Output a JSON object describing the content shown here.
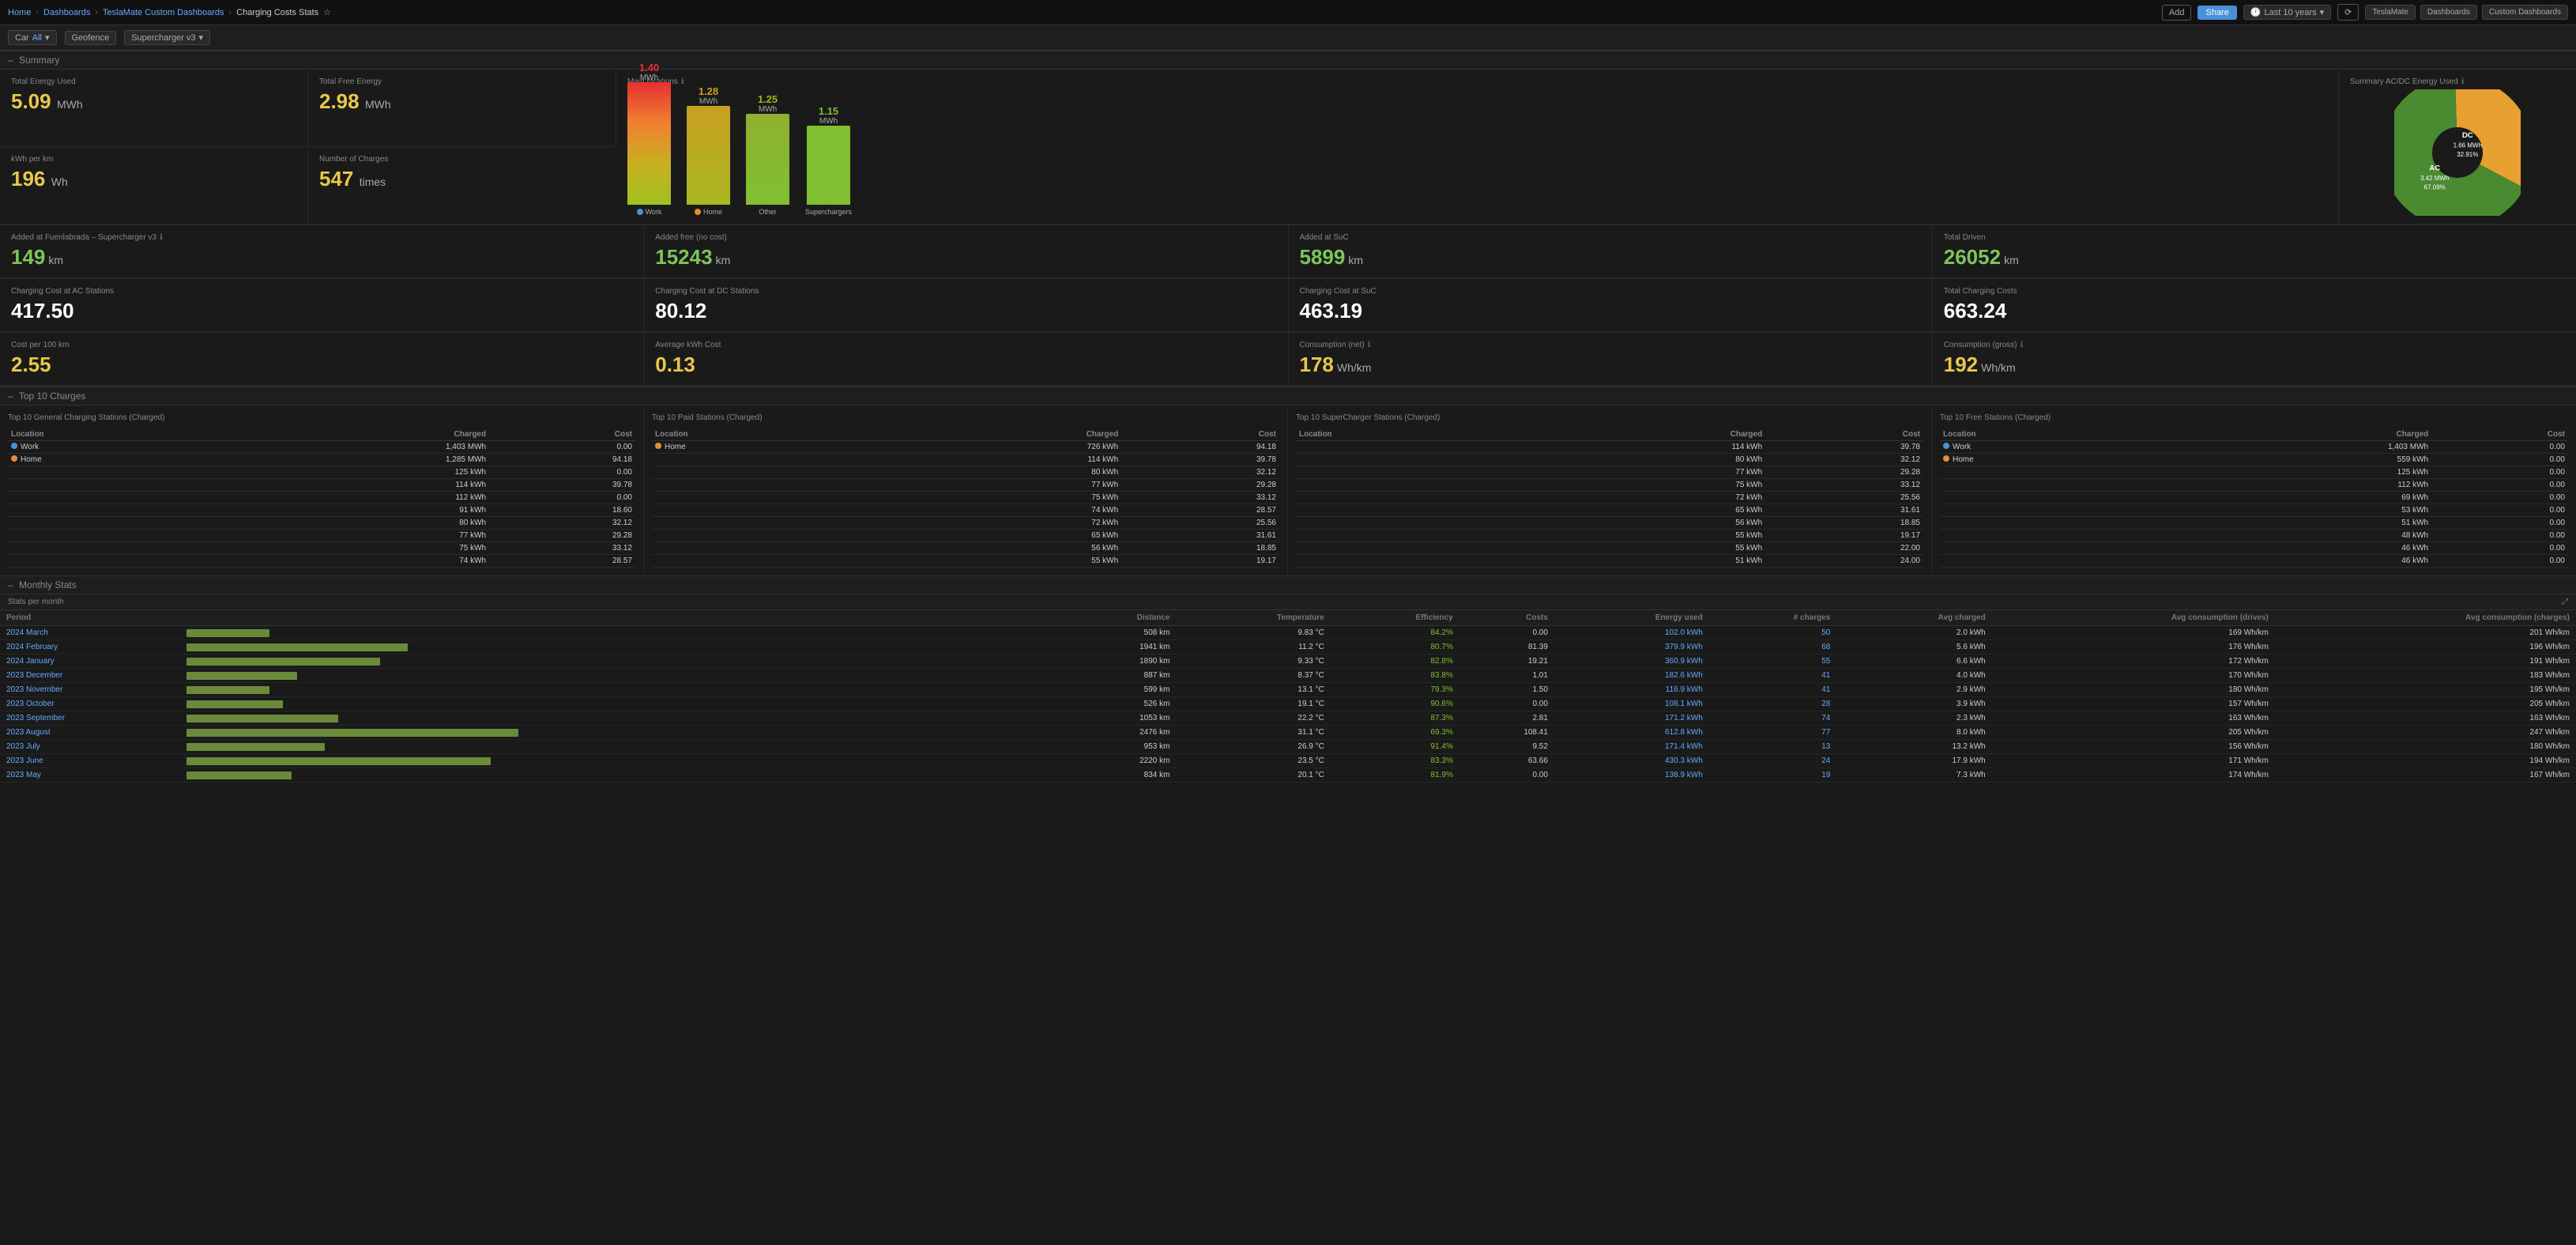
{
  "nav": {
    "home": "Home",
    "dashboards": "Dashboards",
    "teslaMate": "TeslaMate Custom Dashboards",
    "current": "Charging Costs Stats",
    "timeRange": "Last 10 years",
    "addLabel": "Add",
    "shareLabel": "Share",
    "rightButtons": [
      "TeslaMate",
      "Dashboards",
      "Custom Dashboards"
    ]
  },
  "filters": {
    "car": "Car",
    "geofence": "Geofence",
    "chargerType": "Supercharger v3"
  },
  "summary": {
    "title": "Summary",
    "cards": [
      {
        "label": "Total Energy Used",
        "value": "5.09",
        "unit": "MWh",
        "color": "yellow"
      },
      {
        "label": "Total Free Energy",
        "value": "2.98",
        "unit": "MWh",
        "color": "yellow"
      },
      {
        "label": "kWh per km",
        "value": "196",
        "unit": "Wh",
        "color": "yellow"
      },
      {
        "label": "Number of Charges",
        "value": "547",
        "unit": "times",
        "color": "yellow"
      },
      {
        "label": "Main locations",
        "value": "",
        "unit": "",
        "color": "yellow",
        "isChart": true
      },
      {
        "label": "Summary AC/DC Energy Used",
        "value": "",
        "unit": "",
        "color": "yellow",
        "isChart": true
      }
    ],
    "row2": [
      {
        "label": "Added at Fuenlabrada – Supercharger v3",
        "value": "149",
        "unit": "km",
        "color": "green"
      },
      {
        "label": "Added free (no cost)",
        "value": "15243",
        "unit": "km",
        "color": "green"
      },
      {
        "label": "Added at SuC",
        "value": "5899",
        "unit": "km",
        "color": "green"
      },
      {
        "label": "Total Driven",
        "value": "26052",
        "unit": "km",
        "color": "green"
      }
    ],
    "row3": [
      {
        "label": "Charging Cost at AC Stations",
        "value": "417.50",
        "unit": "",
        "color": "white"
      },
      {
        "label": "Charging Cost at DC Stations",
        "value": "80.12",
        "unit": "",
        "color": "white"
      },
      {
        "label": "Charging Cost at SuC",
        "value": "463.19",
        "unit": "",
        "color": "white"
      },
      {
        "label": "Total Charging Costs",
        "value": "663.24",
        "unit": "",
        "color": "white"
      }
    ],
    "row4": [
      {
        "label": "Cost per 100 km",
        "value": "2.55",
        "unit": "",
        "color": "yellow"
      },
      {
        "label": "Average kWh Cost",
        "value": "0.13",
        "unit": "",
        "color": "yellow"
      },
      {
        "label": "Consumption (net)",
        "value": "178",
        "unit": "Wh/km",
        "color": "yellow"
      },
      {
        "label": "Consumption (gross)",
        "value": "192",
        "unit": "Wh/km",
        "color": "yellow"
      }
    ]
  },
  "mainLocations": {
    "title": "Main locations",
    "bars": [
      {
        "label": "Work",
        "value": "1.40",
        "unit": "MWh",
        "height": 160,
        "color": "#e63030"
      },
      {
        "label": "Home",
        "value": "1.28",
        "unit": "MWh",
        "height": 130,
        "color": "#c8a020"
      },
      {
        "label": "Other",
        "value": "1.25",
        "unit": "MWh",
        "height": 120,
        "color": "#a0b820"
      },
      {
        "label": "Superchargers",
        "value": "1.15",
        "unit": "MWh",
        "height": 100,
        "color": "#80c030"
      }
    ]
  },
  "acDcChart": {
    "title": "Summary AC/DC Energy Used",
    "dc": {
      "label": "DC",
      "value": "1.66 MWh",
      "percent": "32.91%",
      "color": "#e8a030"
    },
    "ac": {
      "label": "AC",
      "value": "3.42 MWh",
      "percent": "67.09%",
      "color": "#4a8a30"
    }
  },
  "top10": {
    "title": "Top 10 Charges",
    "general": {
      "title": "Top 10 General Charging Stations (Charged)",
      "headers": [
        "Location",
        "Charged",
        "Cost"
      ],
      "rows": [
        {
          "location": "Work",
          "charged": "1,403 MWh",
          "cost": "0.00",
          "dot": "blue"
        },
        {
          "location": "Home",
          "charged": "1,285 MWh",
          "cost": "94.18",
          "dot": "orange"
        },
        {
          "location": "",
          "charged": "125 kWh",
          "cost": "0.00"
        },
        {
          "location": "",
          "charged": "114 kWh",
          "cost": "39.78"
        },
        {
          "location": "",
          "charged": "112 kWh",
          "cost": "0.00"
        },
        {
          "location": "",
          "charged": "91 kWh",
          "cost": "18.60"
        },
        {
          "location": "",
          "charged": "80 kWh",
          "cost": "32.12"
        },
        {
          "location": "",
          "charged": "77 kWh",
          "cost": "29.28"
        },
        {
          "location": "",
          "charged": "75 kWh",
          "cost": "33.12"
        },
        {
          "location": "",
          "charged": "74 kWh",
          "cost": "28.57"
        }
      ]
    },
    "paid": {
      "title": "Top 10 Paid Stations (Charged)",
      "headers": [
        "Location",
        "Charged",
        "Cost"
      ],
      "rows": [
        {
          "location": "Home",
          "charged": "726 kWh",
          "cost": "94.18",
          "dot": "orange"
        },
        {
          "location": "",
          "charged": "114 kWh",
          "cost": "39.78"
        },
        {
          "location": "",
          "charged": "80 kWh",
          "cost": "32.12"
        },
        {
          "location": "",
          "charged": "77 kWh",
          "cost": "29.28"
        },
        {
          "location": "",
          "charged": "75 kWh",
          "cost": "33.12"
        },
        {
          "location": "",
          "charged": "74 kWh",
          "cost": "28.57"
        },
        {
          "location": "",
          "charged": "72 kWh",
          "cost": "25.56"
        },
        {
          "location": "",
          "charged": "65 kWh",
          "cost": "31.61"
        },
        {
          "location": "",
          "charged": "56 kWh",
          "cost": "18.85"
        },
        {
          "location": "",
          "charged": "55 kWh",
          "cost": "19.17"
        }
      ]
    },
    "supercharger": {
      "title": "Top 10 SuperCharger Stations (Charged)",
      "headers": [
        "Location",
        "Charged",
        "Cost"
      ],
      "rows": [
        {
          "location": "",
          "charged": "114 kWh",
          "cost": "39.78"
        },
        {
          "location": "",
          "charged": "80 kWh",
          "cost": "32.12"
        },
        {
          "location": "",
          "charged": "77 kWh",
          "cost": "29.28"
        },
        {
          "location": "",
          "charged": "75 kWh",
          "cost": "33.12"
        },
        {
          "location": "",
          "charged": "72 kWh",
          "cost": "25.56"
        },
        {
          "location": "",
          "charged": "65 kWh",
          "cost": "31.61"
        },
        {
          "location": "",
          "charged": "56 kWh",
          "cost": "18.85"
        },
        {
          "location": "",
          "charged": "55 kWh",
          "cost": "19.17"
        },
        {
          "location": "",
          "charged": "55 kWh",
          "cost": "22.00"
        },
        {
          "location": "",
          "charged": "51 kWh",
          "cost": "24.00"
        }
      ]
    },
    "free": {
      "title": "Top 10 Free Stations (Charged)",
      "headers": [
        "Location",
        "Charged",
        "Cost"
      ],
      "rows": [
        {
          "location": "Work",
          "charged": "1,403 MWh",
          "cost": "0.00",
          "dot": "blue"
        },
        {
          "location": "Home",
          "charged": "559 kWh",
          "cost": "0.00",
          "dot": "orange"
        },
        {
          "location": "",
          "charged": "125 kWh",
          "cost": "0.00"
        },
        {
          "location": "",
          "charged": "112 kWh",
          "cost": "0.00"
        },
        {
          "location": "",
          "charged": "69 kWh",
          "cost": "0.00"
        },
        {
          "location": "",
          "charged": "53 kWh",
          "cost": "0.00"
        },
        {
          "location": "",
          "charged": "51 kWh",
          "cost": "0.00"
        },
        {
          "location": "",
          "charged": "48 kWh",
          "cost": "0.00"
        },
        {
          "location": "",
          "charged": "46 kWh",
          "cost": "0.00"
        },
        {
          "location": "",
          "charged": "46 kWh",
          "cost": "0.00"
        }
      ]
    }
  },
  "monthly": {
    "title": "Monthly Stats",
    "subtitle": "Stats per month",
    "headers": [
      "Period",
      "",
      "Distance",
      "Temperature",
      "Efficiency",
      "Costs",
      "Energy used",
      "# charges",
      "Avg charged",
      "Avg consumption (drives)",
      "Avg consumption (charges)"
    ],
    "rows": [
      {
        "period": "2024 March",
        "barWidth": 30,
        "distance": "508 km",
        "temp": "9.83 °C",
        "efficiency": "84.2%",
        "costs": "0.00",
        "energy": "102.0 kWh",
        "charges": "50",
        "avgCharged": "2.0 kWh",
        "avgConsumeDrives": "169 Wh/km",
        "avgConsumeCharges": "201 Wh/km"
      },
      {
        "period": "2024 February",
        "barWidth": 80,
        "distance": "1941 km",
        "temp": "11.2 °C",
        "efficiency": "80.7%",
        "costs": "81.39",
        "energy": "379.9 kWh",
        "charges": "68",
        "avgCharged": "5.6 kWh",
        "avgConsumeDrives": "176 Wh/km",
        "avgConsumeCharges": "196 Wh/km"
      },
      {
        "period": "2024 January",
        "barWidth": 70,
        "distance": "1890 km",
        "temp": "9.33 °C",
        "efficiency": "82.8%",
        "costs": "19.21",
        "energy": "360.9 kWh",
        "charges": "55",
        "avgCharged": "6.6 kWh",
        "avgConsumeDrives": "172 Wh/km",
        "avgConsumeCharges": "191 Wh/km"
      },
      {
        "period": "2023 December",
        "barWidth": 40,
        "distance": "887 km",
        "temp": "8.37 °C",
        "efficiency": "83.8%",
        "costs": "1.01",
        "energy": "182.6 kWh",
        "charges": "41",
        "avgCharged": "4.0 kWh",
        "avgConsumeDrives": "170 Wh/km",
        "avgConsumeCharges": "183 Wh/km"
      },
      {
        "period": "2023 November",
        "barWidth": 30,
        "distance": "599 km",
        "temp": "13.1 °C",
        "efficiency": "79.3%",
        "costs": "1.50",
        "energy": "116.9 kWh",
        "charges": "41",
        "avgCharged": "2.9 kWh",
        "avgConsumeDrives": "180 Wh/km",
        "avgConsumeCharges": "195 Wh/km"
      },
      {
        "period": "2023 October",
        "barWidth": 35,
        "distance": "526 km",
        "temp": "19.1 °C",
        "efficiency": "90.6%",
        "costs": "0.00",
        "energy": "108.1 kWh",
        "charges": "28",
        "avgCharged": "3.9 kWh",
        "avgConsumeDrives": "157 Wh/km",
        "avgConsumeCharges": "205 Wh/km"
      },
      {
        "period": "2023 September",
        "barWidth": 55,
        "distance": "1053 km",
        "temp": "22.2 °C",
        "efficiency": "87.3%",
        "costs": "2.81",
        "energy": "171.2 kWh",
        "charges": "74",
        "avgCharged": "2.3 kWh",
        "avgConsumeDrives": "163 Wh/km",
        "avgConsumeCharges": "163 Wh/km"
      },
      {
        "period": "2023 August",
        "barWidth": 120,
        "distance": "2476 km",
        "temp": "31.1 °C",
        "efficiency": "69.3%",
        "costs": "108.41",
        "energy": "612.8 kWh",
        "charges": "77",
        "avgCharged": "8.0 kWh",
        "avgConsumeDrives": "205 Wh/km",
        "avgConsumeCharges": "247 Wh/km"
      },
      {
        "period": "2023 July",
        "barWidth": 50,
        "distance": "953 km",
        "temp": "26.9 °C",
        "efficiency": "91.4%",
        "costs": "9.52",
        "energy": "171.4 kWh",
        "charges": "13",
        "avgCharged": "13.2 kWh",
        "avgConsumeDrives": "156 Wh/km",
        "avgConsumeCharges": "180 Wh/km"
      },
      {
        "period": "2023 June",
        "barWidth": 110,
        "distance": "2220 km",
        "temp": "23.5 °C",
        "efficiency": "83.3%",
        "costs": "63.66",
        "energy": "430.3 kWh",
        "charges": "24",
        "avgCharged": "17.9 kWh",
        "avgConsumeDrives": "171 Wh/km",
        "avgConsumeCharges": "194 Wh/km"
      },
      {
        "period": "2023 May",
        "barWidth": 38,
        "distance": "834 km",
        "temp": "20.1 °C",
        "efficiency": "81.9%",
        "costs": "0.00",
        "energy": "138.9 kWh",
        "charges": "19",
        "avgCharged": "7.3 kWh",
        "avgConsumeDrives": "174 Wh/km",
        "avgConsumeCharges": "167 Wh/km"
      }
    ]
  }
}
